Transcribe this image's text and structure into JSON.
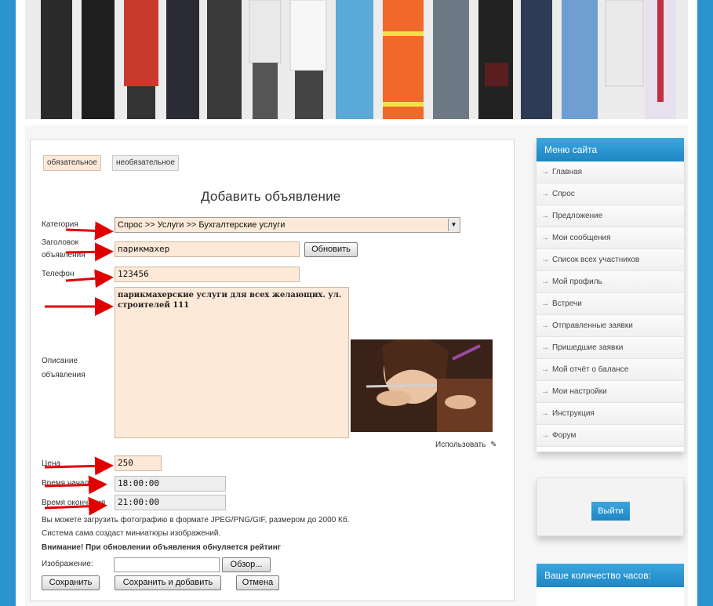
{
  "legend": {
    "required": "обязательное",
    "optional": "необязательное"
  },
  "form": {
    "title": "Добавить объявление",
    "category_label": "Категория",
    "category_value": "Спрос >> Услуги >> Бухгалтерские  услуги",
    "heading_label_line1": "Заголовок",
    "heading_label_line2": "объявления",
    "heading_value": "парикмахер",
    "update_button": "Обновить",
    "phone_label": "Телефон",
    "phone_value": "123456",
    "description_label_line1": "Описание",
    "description_label_line2": "объявления",
    "description_value": "парикмахерские услуги для всех желающих. ул. строителей 111",
    "use_label": "Использовать",
    "price_label": "Цена",
    "price_value": "250",
    "start_label": "Время начала",
    "start_value": "18:00:00",
    "end_label": "Время окончания",
    "end_value": "21:00:00",
    "upload_note1": "Вы можете загрузить фотографию в формате JPEG/PNG/GIF, размером до 2000 Кб.",
    "upload_note2": "Система сама создаст миниатюры изображений.",
    "warning": "Внимание! При обновлении объявления обнуляется рейтинг",
    "image_label": "Изображение:",
    "browse_button": "Обзор...",
    "save_button": "Сохранить",
    "save_add_button": "Сохранить  и добавить",
    "cancel_button": "Отмена"
  },
  "sidebar": {
    "menu_title": "Меню сайта",
    "items": [
      "Главная",
      "Спрос",
      "Предложение",
      "Мои сообщения",
      "Список всех участников",
      "Мой профиль",
      "Встречи",
      "Отправленные заявки",
      "Пришедшие заявки",
      "Мой отчёт о балансе",
      "Мои настройки",
      "Инструкция",
      "Форум"
    ],
    "logout_button": "Выйти",
    "hours_title": "Ваше количество часов:"
  },
  "colors": {
    "accent": "#2b94cf",
    "required_field": "#fde9d8",
    "arrow": "#e00000"
  }
}
